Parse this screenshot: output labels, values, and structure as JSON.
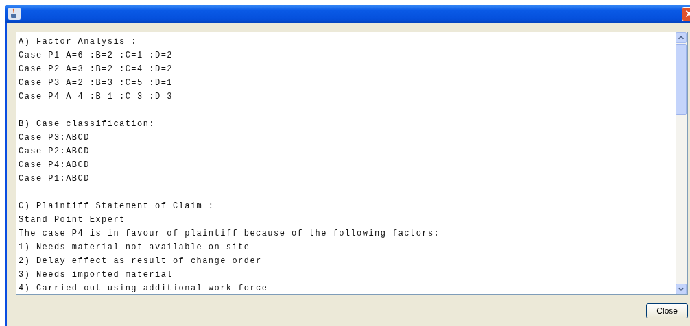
{
  "sections": [
    {
      "lines": [
        "A) Factor Analysis :",
        "Case P1 A=6 :B=2 :C=1 :D=2",
        "Case P2 A=3 :B=2 :C=4 :D=2",
        "Case P3 A=2 :B=3 :C=5 :D=1",
        "Case P4 A=4 :B=1 :C=3 :D=3"
      ]
    },
    {
      "lines": [
        "B) Case classification:",
        "Case P3:ABCD",
        "Case P2:ABCD",
        "Case P4:ABCD",
        "Case P1:ABCD"
      ]
    },
    {
      "lines": [
        "C) Plaintiff Statement of Claim :",
        "Stand Point Expert",
        "The case P4 is in favour of plaintiff because of the following factors:",
        "1) Needs material not available on site",
        "2) Delay effect as result of change order",
        "3) Needs imported material",
        "4) Carried out using additional work force"
      ]
    }
  ],
  "buttons": [
    {
      "label": "Close"
    }
  ]
}
